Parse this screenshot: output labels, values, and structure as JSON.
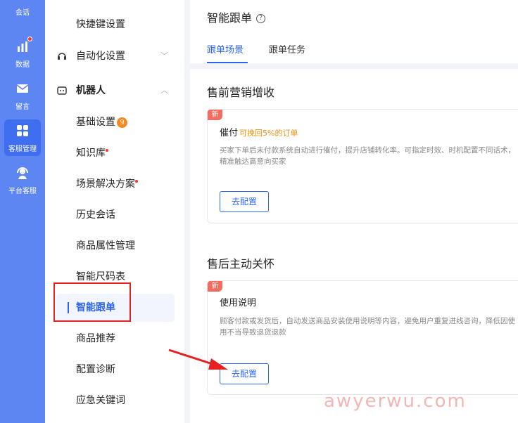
{
  "rail": [
    {
      "label": "会话",
      "icon": "chat-icon"
    },
    {
      "label": "数据",
      "icon": "bar-chart-icon"
    },
    {
      "label": "留言",
      "icon": "mail-icon"
    },
    {
      "label": "客服管理",
      "icon": "grid-icon"
    },
    {
      "label": "平台客服",
      "icon": "headset-icon"
    }
  ],
  "sidebar": {
    "shortcut": "快捷键设置",
    "automation": "自动化设置",
    "robot": "机器人",
    "basic": "基础设置",
    "basic_badge": "9",
    "knowledge": "知识库",
    "scene": "场景解决方案",
    "history": "历史会话",
    "attr": "商品属性管理",
    "size": "智能尺码表",
    "follow": "智能跟单",
    "recommend": "商品推荐",
    "diagnose": "配置诊断",
    "emergency": "应急关键词"
  },
  "main": {
    "title": "智能跟单",
    "help": "?",
    "tabs": [
      "跟单场景",
      "跟单任务"
    ],
    "section1": "售前营销增收",
    "card1": {
      "tag": "新",
      "title": "催付",
      "highlight": "可挽回5%的订单",
      "desc": "买家下单后未付款系统自动进行催付，提升店铺转化率。可指定时效、时机配置不同话术，精准触达高意向买家",
      "button": "去配置"
    },
    "section2": "售后主动关怀",
    "card2": {
      "tag": "新",
      "title": "使用说明",
      "desc": "顾客付款或发货后，自动发送商品安装使用说明等内容，避免用户重复进线咨询，降低因使用不当导致退货退款",
      "button": "去配置"
    }
  },
  "watermark": "awyerwu.com",
  "colors": {
    "accent": "#2d64f0",
    "rail": "#5d86f3",
    "highlight": "#f0900d",
    "annotation": "#e52121"
  }
}
